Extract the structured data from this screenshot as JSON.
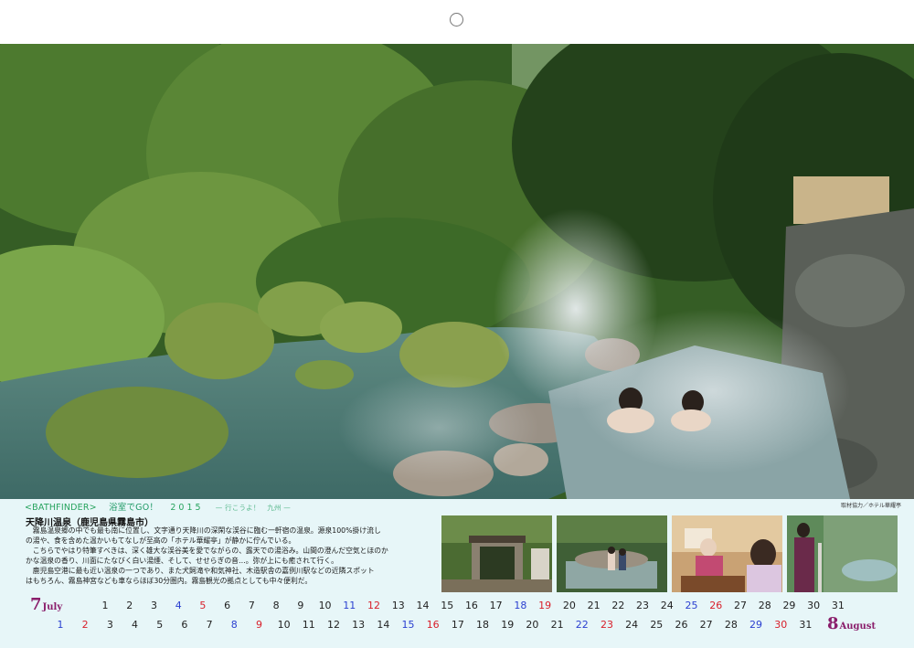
{
  "header": {
    "tag": "<BATHFINDER>",
    "title": "浴室でGO！",
    "year": "2015",
    "subtitle": "— 行こうよ！　九州 —",
    "credit": "取材協力／ホテル華耀亭"
  },
  "article": {
    "title": "天降川温泉（鹿児島県霧島市）",
    "lines": [
      "　霧島温泉郷の中でも最も南に位置し、文字通り天降川の深閑な渓谷に臨む一軒宿の温泉。源泉100%掛け流し",
      "の湯や、食を含めた温かいもてなしが至高の「ホテル華耀亭」が静かに佇んでいる。",
      "　こちらでやはり特筆すべきは、深く雄大な渓谷美を愛でながらの、露天での湯浴み。山間の澄んだ空気とほのか",
      "かな温泉の香り、川面にたなびく白い湯煙、そして、せせらぎの音…。弥が上にも癒されて行く。",
      "　鹿児島空港に最も近い温泉の一つであり、また犬飼滝や和気神社、木造駅舎の嘉例川駅などの近隣スポット",
      "はもちろん、霧島神宮なども車ならほぼ30分圏内。霧島観光の拠点としても中々便利だ。"
    ]
  },
  "thumbnails": [
    "gate-photo",
    "bath-guests-photo",
    "dinner-photo",
    "kimono-woman-photo"
  ],
  "calendar": {
    "july": {
      "number": "7",
      "name": "July",
      "days": [
        "1",
        "2",
        "3",
        "4",
        "5",
        "6",
        "7",
        "8",
        "9",
        "10",
        "11",
        "12",
        "13",
        "14",
        "15",
        "16",
        "17",
        "18",
        "19",
        "20",
        "21",
        "22",
        "23",
        "24",
        "25",
        "26",
        "27",
        "28",
        "29",
        "30",
        "31"
      ]
    },
    "august": {
      "number": "8",
      "name": "August",
      "days": [
        "1",
        "2",
        "3",
        "4",
        "5",
        "6",
        "7",
        "8",
        "9",
        "10",
        "11",
        "12",
        "13",
        "14",
        "15",
        "16",
        "17",
        "18",
        "19",
        "20",
        "21",
        "22",
        "23",
        "24",
        "25",
        "26",
        "27",
        "28",
        "29",
        "30",
        "31"
      ]
    },
    "colors": {
      "saturday": "#2a3fd0",
      "sunday": "#d81f2a",
      "month": "#8a1e6b"
    }
  }
}
